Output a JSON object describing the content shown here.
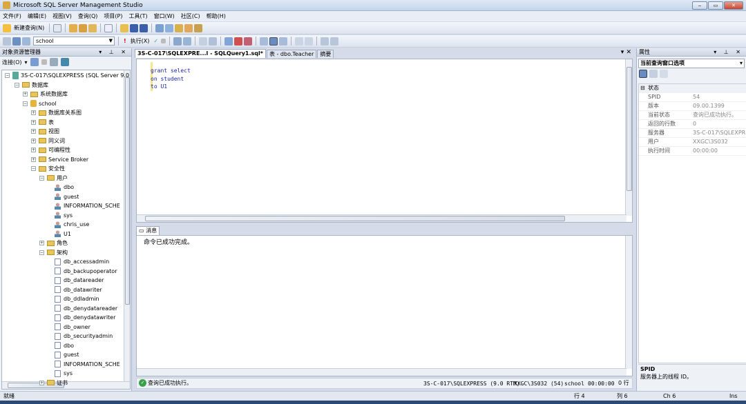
{
  "window": {
    "title": "Microsoft SQL Server Management Studio",
    "min": "‒",
    "max": "▭",
    "close": "✕"
  },
  "menu": [
    "文件(F)",
    "编辑(E)",
    "视图(V)",
    "查询(Q)",
    "项目(P)",
    "工具(T)",
    "窗口(W)",
    "社区(C)",
    "帮助(H)"
  ],
  "toolbar1": {
    "new_query": "新建查询(N)"
  },
  "toolbar2": {
    "database": "school",
    "execute": "执行(X)"
  },
  "object_explorer": {
    "title": "对象资源管理器",
    "connect": "连接(O)",
    "nodes": [
      "3S-C-017\\SQLEXPRESS (SQL Server 9.0",
      "数据库",
      "系统数据库",
      "school",
      "数据库关系图",
      "表",
      "视图",
      "同义词",
      "可编程性",
      "Service Broker",
      "安全性",
      "用户",
      "dbo",
      "guest",
      "INFORMATION_SCHE",
      "sys",
      "chris_use",
      "U1",
      "角色",
      "架构",
      "db_accessadmin",
      "db_backupoperator",
      "db_datareader",
      "db_datawriter",
      "db_ddladmin",
      "db_denydatareader",
      "db_denydatawriter",
      "db_owner",
      "db_securityadmin",
      "dbo",
      "guest",
      "INFORMATION_SCHE",
      "sys",
      "证书"
    ]
  },
  "editor": {
    "tabs": [
      "3S-C-017\\SQLEXPRE...l - SQLQuery1.sql*",
      "表 - dbo.Teacher",
      "摘要"
    ],
    "close": "▾ ✕",
    "lines": [
      "grant select",
      "on student",
      "to U1"
    ]
  },
  "messages": {
    "tab": "消息",
    "text": "命令已成功完成。"
  },
  "query_status": {
    "text": "查询已成功执行。",
    "server": "3S-C-017\\SQLEXPRESS (9.0 RTM)",
    "user": "XXGC\\3S032 (54)",
    "db": "school",
    "time": "00:00:00",
    "rows": "0 行"
  },
  "properties": {
    "title": "属性",
    "selector": "当前查询窗口选项",
    "group": "状态",
    "rows": [
      [
        "SPID",
        "54"
      ],
      [
        "版本",
        "09.00.1399"
      ],
      [
        "当前状态",
        "查询已成功执行。"
      ],
      [
        "返回的行数",
        "0"
      ],
      [
        "服务器",
        "3S-C-017\\SQLEXPRE"
      ],
      [
        "用户",
        "XXGC\\3S032"
      ],
      [
        "执行时间",
        "00:00:00"
      ]
    ],
    "desc_title": "SPID",
    "desc_text": "服务器上的线程 ID。"
  },
  "statusbar": {
    "ready": "就绪",
    "line": "行 4",
    "col": "列 6",
    "ch": "Ch 6",
    "ins": "Ins"
  }
}
